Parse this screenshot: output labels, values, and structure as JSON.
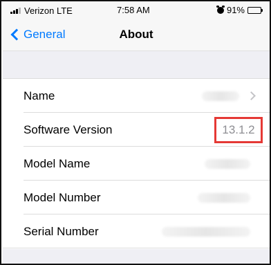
{
  "status_bar": {
    "carrier": "Verizon LTE",
    "time": "7:58 AM",
    "battery": "91%"
  },
  "nav": {
    "back_label": "General",
    "title": "About"
  },
  "rows": [
    {
      "label": "Name",
      "value": ""
    },
    {
      "label": "Software Version",
      "value": "13.1.2"
    },
    {
      "label": "Model Name",
      "value": ""
    },
    {
      "label": "Model Number",
      "value": ""
    },
    {
      "label": "Serial Number",
      "value": ""
    }
  ],
  "colors": {
    "accent": "#007aff",
    "highlight": "#e53935",
    "secondary_text": "#8e8e93",
    "grouped_background": "#efeff4"
  },
  "icons": [
    "signal-icon",
    "alarm-icon",
    "battery-icon",
    "chevron-left-icon",
    "chevron-right-icon"
  ]
}
